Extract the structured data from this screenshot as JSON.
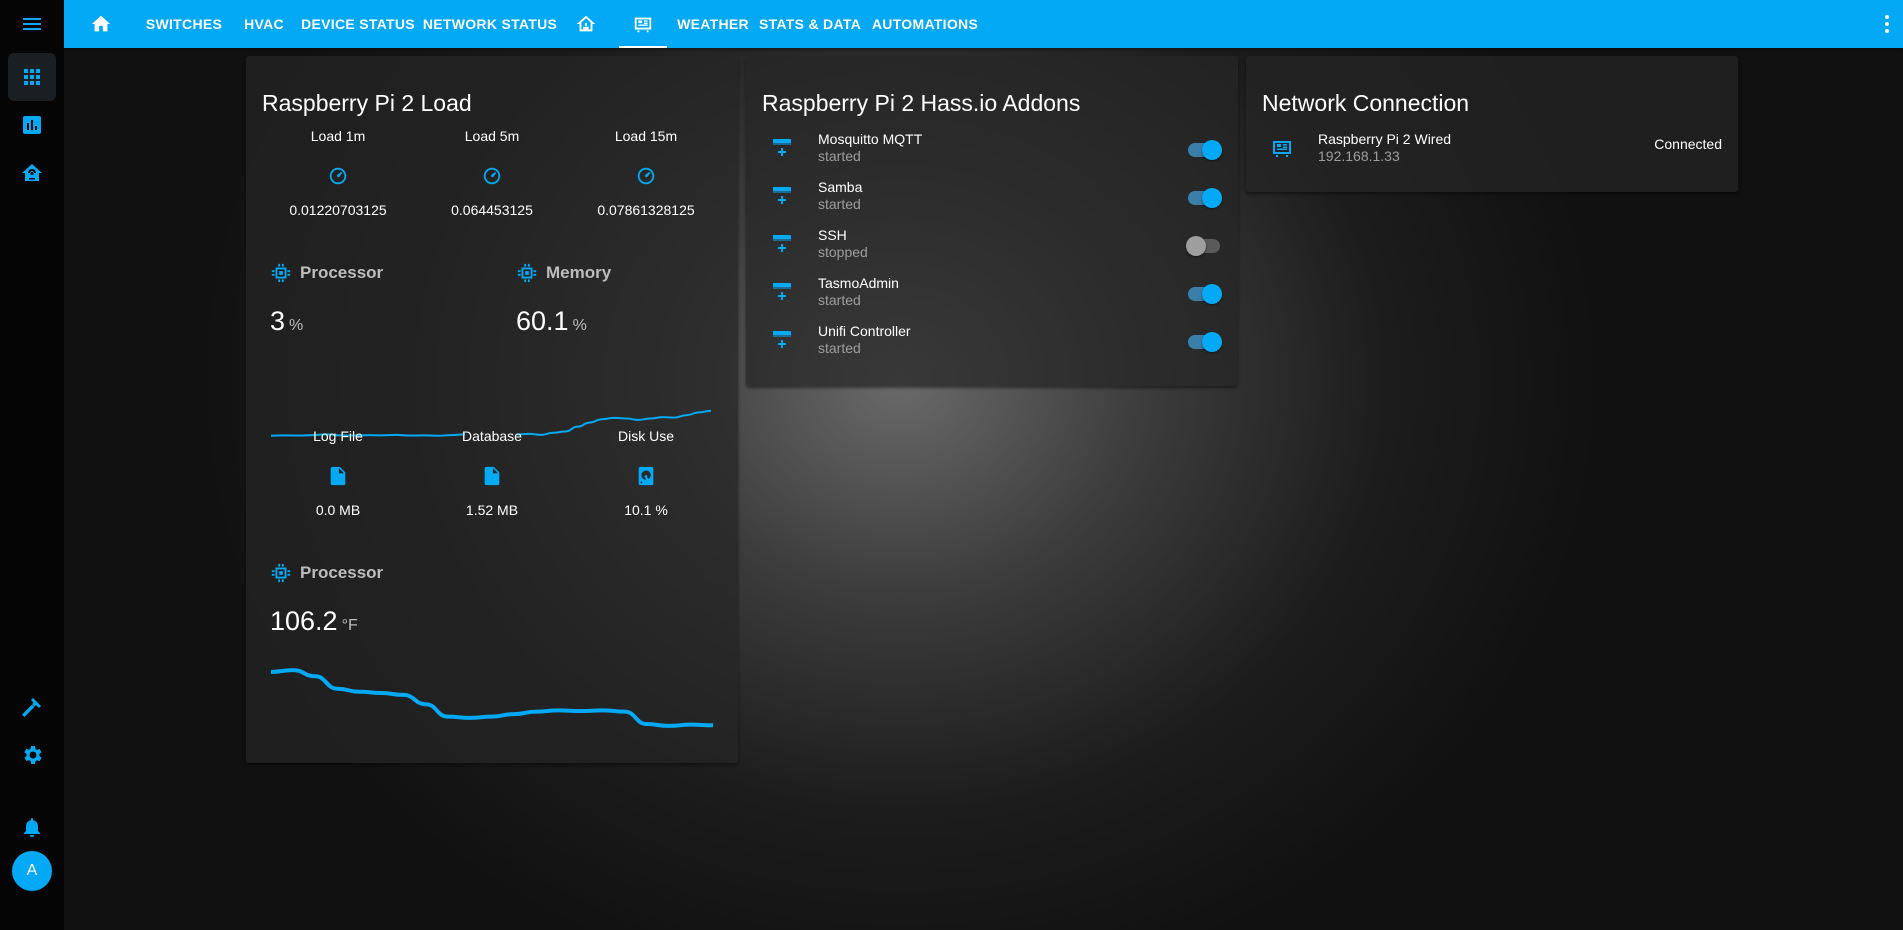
{
  "sidebar": {
    "items": [
      {
        "name": "overview",
        "icon": "view-dashboard-icon",
        "active": true
      },
      {
        "name": "history",
        "icon": "chart-box-icon",
        "active": false
      },
      {
        "name": "energy",
        "icon": "home-automation-icon",
        "active": false
      },
      {
        "name": "developer-tools",
        "icon": "hammer-icon",
        "active": false
      },
      {
        "name": "settings",
        "icon": "gear-icon",
        "active": false
      },
      {
        "name": "notifications",
        "icon": "bell-icon",
        "active": false
      }
    ],
    "avatar_initial": "A"
  },
  "topbar": {
    "tabs": [
      {
        "label": "",
        "icon": "home-icon"
      },
      {
        "label": "SWITCHES"
      },
      {
        "label": "HVAC"
      },
      {
        "label": "DEVICE STATUS"
      },
      {
        "label": "NETWORK STATUS"
      },
      {
        "label": "",
        "icon": "home-network-icon"
      },
      {
        "label": "",
        "icon": "raspberry-pi-icon",
        "active": true
      },
      {
        "label": "WEATHER"
      },
      {
        "label": "STATS & DATA"
      },
      {
        "label": "AUTOMATIONS"
      }
    ]
  },
  "load_card": {
    "title": "Raspberry Pi 2 Load",
    "load": [
      {
        "name": "Load 1m",
        "value": "0.01220703125",
        "icon": "gauge-icon"
      },
      {
        "name": "Load 5m",
        "value": "0.064453125",
        "icon": "gauge-icon"
      },
      {
        "name": "Load 15m",
        "value": "0.07861328125",
        "icon": "gauge-icon"
      }
    ],
    "processor": {
      "name": "Processor",
      "value": "3",
      "unit": "%",
      "icon": "chip-icon",
      "history": [
        0.3,
        0.32,
        0.31,
        0.33,
        0.36,
        0.32,
        0.31,
        0.33,
        0.32,
        0.34,
        0.31,
        0.32,
        0.3,
        0.33,
        0.36
      ]
    },
    "memory": {
      "name": "Memory",
      "value": "60.1",
      "unit": "%",
      "icon": "chip-icon",
      "history": [
        0.25,
        0.27,
        0.24,
        0.3,
        0.34,
        0.48,
        0.6,
        0.7,
        0.74,
        0.72,
        0.68,
        0.72,
        0.76,
        0.75,
        0.82,
        0.9,
        0.95
      ]
    },
    "storage": [
      {
        "name": "Log File",
        "value": "0.0 MB",
        "icon": "file-icon"
      },
      {
        "name": "Database",
        "value": "1.52 MB",
        "icon": "file-icon"
      },
      {
        "name": "Disk Use",
        "value": "10.1 %",
        "icon": "harddisk-icon"
      }
    ],
    "temperature": {
      "name": "Processor",
      "value": "106.2",
      "unit": "°F",
      "icon": "chip-icon",
      "history": [
        0.92,
        0.95,
        0.85,
        0.65,
        0.6,
        0.58,
        0.55,
        0.4,
        0.2,
        0.18,
        0.2,
        0.24,
        0.28,
        0.3,
        0.29,
        0.3,
        0.28,
        0.08,
        0.05,
        0.07,
        0.06
      ]
    }
  },
  "addons_card": {
    "title": "Raspberry Pi 2 Hass.io Addons",
    "addons": [
      {
        "name": "Mosquitto MQTT",
        "state": "started",
        "on": true
      },
      {
        "name": "Samba",
        "state": "started",
        "on": true
      },
      {
        "name": "SSH",
        "state": "stopped",
        "on": false
      },
      {
        "name": "TasmoAdmin",
        "state": "started",
        "on": true
      },
      {
        "name": "Unifi Controller",
        "state": "started",
        "on": true
      }
    ]
  },
  "network_card": {
    "title": "Network Connection",
    "entity": {
      "name": "Raspberry Pi 2 Wired",
      "ip": "192.168.1.33",
      "status": "Connected",
      "icon": "raspberry-pi-icon"
    }
  },
  "colors": {
    "accent": "#03a9f4",
    "sidebar": "#050505"
  }
}
